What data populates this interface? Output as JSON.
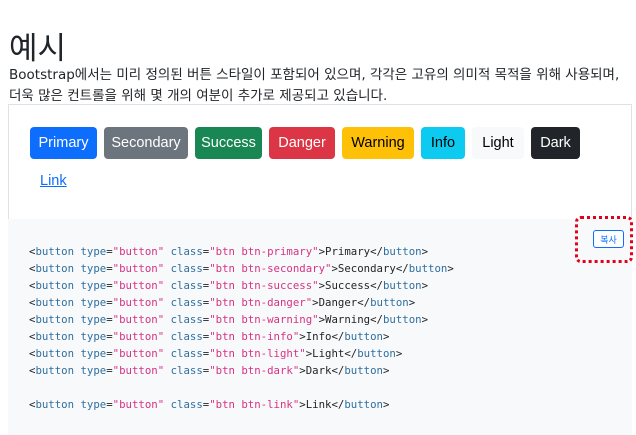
{
  "page": {
    "title": "예시",
    "description": "Bootstrap에서는 미리 정의된 버튼 스타일이 포함되어 있으며, 각각은 고유의 의미적 목적을 위해 사용되며, 더욱 많은 컨트롤을 위해 몇 개의 여분이 추가로 제공되고 있습니다."
  },
  "buttons": {
    "primary": "Primary",
    "secondary": "Secondary",
    "success": "Success",
    "danger": "Danger",
    "warning": "Warning",
    "info": "Info",
    "light": "Light",
    "dark": "Dark",
    "link": "Link"
  },
  "copy_button": {
    "label": "복사"
  },
  "code": {
    "lines": [
      {
        "cls": "btn btn-primary",
        "text": "Primary"
      },
      {
        "cls": "btn btn-secondary",
        "text": "Secondary"
      },
      {
        "cls": "btn btn-success",
        "text": "Success"
      },
      {
        "cls": "btn btn-danger",
        "text": "Danger"
      },
      {
        "cls": "btn btn-warning",
        "text": "Warning"
      },
      {
        "cls": "btn btn-info",
        "text": "Info"
      },
      {
        "cls": "btn btn-light",
        "text": "Light"
      },
      {
        "cls": "btn btn-dark",
        "text": "Dark"
      },
      null,
      {
        "cls": "btn btn-link",
        "text": "Link"
      }
    ]
  },
  "colors": {
    "primary": "#0d6efd",
    "secondary": "#6c757d",
    "success": "#198754",
    "danger": "#dc3545",
    "warning": "#ffc107",
    "info": "#0dcaf0",
    "light": "#f8f9fa",
    "dark": "#212529",
    "highlight_border": "#e3001b"
  }
}
